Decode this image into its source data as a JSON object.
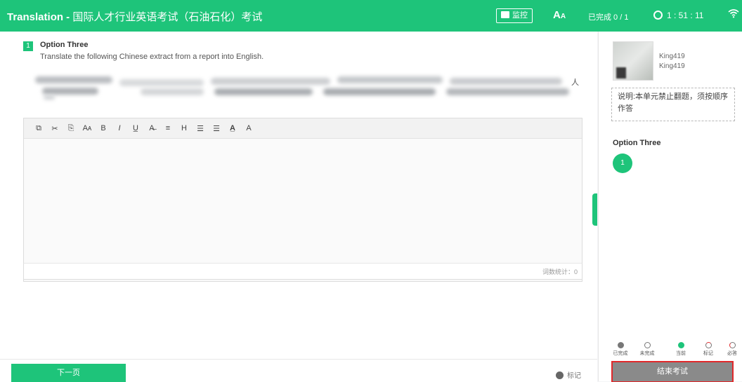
{
  "header": {
    "title_en": "Translation - ",
    "title_cn": "国际人才行业英语考试（石油石化）考试",
    "monitor_label": "监控",
    "font_label": "A",
    "font_small": "A",
    "progress": "已完成 0 / 1",
    "timer": "1 : 51 : 11"
  },
  "question": {
    "number": "1",
    "title": "Option Three",
    "instruction": "Translate the following Chinese extract from a report into English.",
    "blurred_tail": "人"
  },
  "editor": {
    "tools": [
      "source-icon",
      "cut-icon",
      "paste-icon",
      "font-size-icon",
      "bold-icon",
      "italic-icon",
      "underline-icon",
      "superscript-icon",
      "strikethrough-icon",
      "subscript-icon",
      "align-left-icon",
      "align-right-icon",
      "font-color-icon",
      "font-icon"
    ],
    "tool_glyphs": [
      "⧉",
      "✂",
      "⎘",
      "Aᴀ",
      "B",
      "I",
      "U̲",
      "A̶",
      "≡",
      "H",
      "☰",
      "☰",
      "A̲",
      "A"
    ],
    "word_count_label": "词数统计：0"
  },
  "sidebar": {
    "username1": "King419",
    "username2": "King419",
    "note": "说明:本单元禁止翻题，须按顺序作答",
    "section_title": "Option Three",
    "question_number": "1",
    "legend": [
      {
        "label": "已完成",
        "color": "#777777",
        "style": "filled"
      },
      {
        "label": "未完成",
        "color": "#777777",
        "style": "outline"
      },
      {
        "label": "当前",
        "color": "#1ec47a",
        "style": "filled"
      },
      {
        "label": "标记",
        "color": "#e1282a",
        "style": "outline"
      },
      {
        "label": "必答",
        "color": "#e1282a",
        "style": "half"
      }
    ],
    "end_exam_label": "结束考试"
  },
  "footer": {
    "next_label": "下一页",
    "mark_label": "标记"
  },
  "colors": {
    "accent": "#1ec47a",
    "danger": "#e1282a"
  }
}
